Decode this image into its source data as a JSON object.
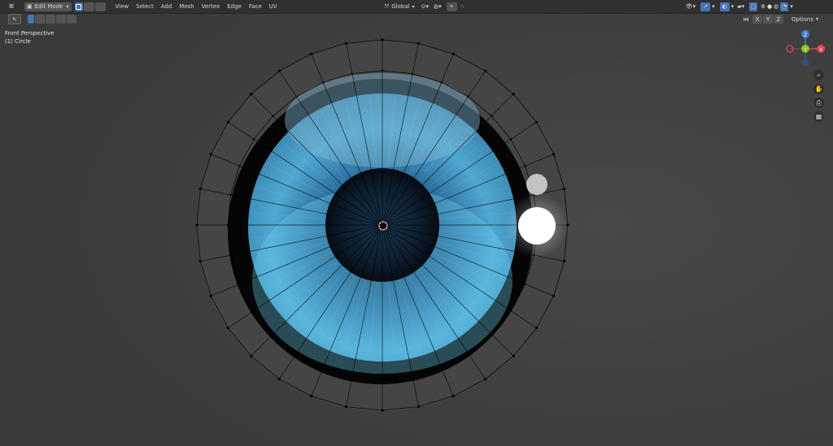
{
  "header": {
    "mode_label": "Edit Mode",
    "menus": [
      "View",
      "Select",
      "Add",
      "Mesh",
      "Vertex",
      "Edge",
      "Face",
      "UV"
    ],
    "transform_orientation": "Global",
    "options_label": "Options"
  },
  "axis_buttons": [
    "X",
    "Y",
    "Z"
  ],
  "overlay": {
    "view_name": "Front Perspective",
    "object_name": "(1) Circle"
  },
  "gizmo": {
    "x_label": "X",
    "y_label": "Y",
    "z_label": "Z",
    "x_color": "#e0455a",
    "y_color": "#8bc21b",
    "z_color": "#3f7fd6"
  },
  "colors": {
    "accent": "#4772b3",
    "iris_light": "#5fc2e8",
    "iris_dark": "#1e4a70",
    "pupil": "#0b1620"
  },
  "icons": [
    "editor-type-icon",
    "vertex-select-icon",
    "edge-select-icon",
    "face-select-icon",
    "snap-icon",
    "proportional-edit-icon",
    "zoom-icon",
    "hand-icon",
    "camera-icon",
    "grid-icon"
  ]
}
